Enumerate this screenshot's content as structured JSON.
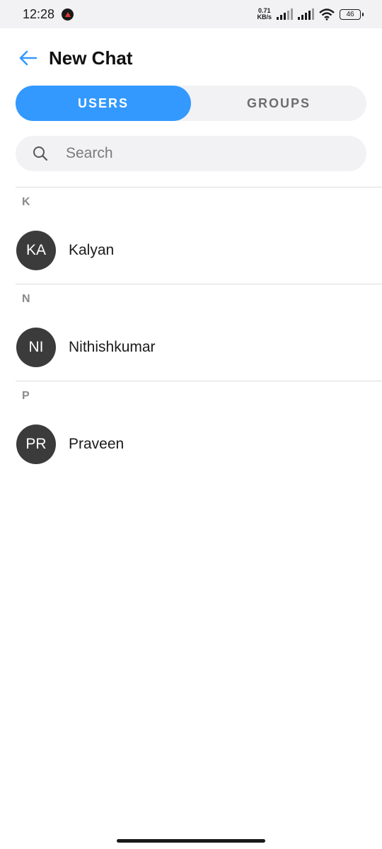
{
  "status_bar": {
    "time": "12:28",
    "net_speed_value": "0.71",
    "net_speed_unit": "KB/s",
    "battery_level": "46"
  },
  "header": {
    "title": "New Chat"
  },
  "tabs": [
    {
      "label": "USERS",
      "active": true
    },
    {
      "label": "GROUPS",
      "active": false
    }
  ],
  "search": {
    "placeholder": "Search",
    "value": ""
  },
  "sections": [
    {
      "letter": "K",
      "contacts": [
        {
          "initials": "KA",
          "name": "Kalyan"
        }
      ]
    },
    {
      "letter": "N",
      "contacts": [
        {
          "initials": "NI",
          "name": "Nithishkumar"
        }
      ]
    },
    {
      "letter": "P",
      "contacts": [
        {
          "initials": "PR",
          "name": "Praveen"
        }
      ]
    }
  ],
  "colors": {
    "accent": "#3399ff",
    "avatar_bg": "#3b3b3b",
    "back_arrow": "#3399ff"
  }
}
